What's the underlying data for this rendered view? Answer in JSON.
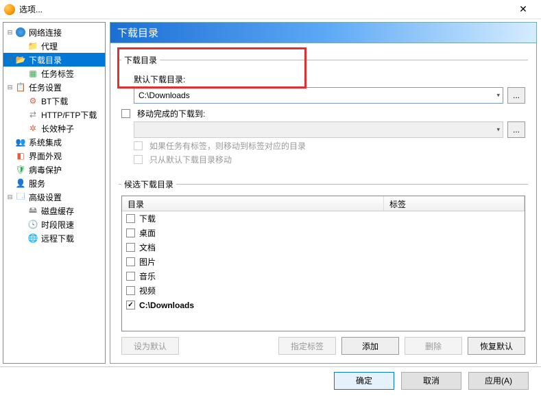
{
  "window": {
    "title": "选项..."
  },
  "sidebar": {
    "items": [
      {
        "label": "网络连接",
        "icon": "globe",
        "level": 0,
        "expanded": true
      },
      {
        "label": "代理",
        "icon": "folder",
        "level": 1
      },
      {
        "label": "下载目录",
        "icon": "folder-open",
        "level": 0,
        "expanded": true,
        "selected": true
      },
      {
        "label": "任务标签",
        "icon": "tag",
        "level": 1
      },
      {
        "label": "任务设置",
        "icon": "clip",
        "level": 0,
        "expanded": true
      },
      {
        "label": "BT下载",
        "icon": "bt",
        "level": 1
      },
      {
        "label": "HTTP/FTP下载",
        "icon": "http",
        "level": 1
      },
      {
        "label": "长效种子",
        "icon": "seed",
        "level": 1
      },
      {
        "label": "系统集成",
        "icon": "users",
        "level": 0
      },
      {
        "label": "界面外观",
        "icon": "ui",
        "level": 0
      },
      {
        "label": "病毒保护",
        "icon": "shield",
        "level": 0
      },
      {
        "label": "服务",
        "icon": "services",
        "level": 0
      },
      {
        "label": "高级设置",
        "icon": "adv",
        "level": 0,
        "expanded": true
      },
      {
        "label": "磁盘缓存",
        "icon": "disk",
        "level": 1
      },
      {
        "label": "时段限速",
        "icon": "time",
        "level": 1
      },
      {
        "label": "远程下载",
        "icon": "remote",
        "level": 1
      }
    ]
  },
  "panel": {
    "header": "下载目录",
    "group1_legend": "下载目录",
    "default_dir_label": "默认下载目录:",
    "default_dir_value": "C:\\Downloads",
    "move_complete_label": "移动完成的下载到:",
    "move_complete_value": "",
    "move_if_tag_label": "如果任务有标签，则移动到标签对应的目录",
    "move_from_default_label": "只从默认下载目录移动",
    "group2_legend": "候选下载目录",
    "table": {
      "col_dir": "目录",
      "col_tag": "标签",
      "rows": [
        {
          "label": "下载",
          "checked": false
        },
        {
          "label": "桌面",
          "checked": false
        },
        {
          "label": "文档",
          "checked": false
        },
        {
          "label": "图片",
          "checked": false
        },
        {
          "label": "音乐",
          "checked": false
        },
        {
          "label": "视频",
          "checked": false
        },
        {
          "label": "C:\\Downloads",
          "checked": true
        }
      ]
    },
    "btn_set_default": "设为默认",
    "btn_assign_tag": "指定标签",
    "btn_add": "添加",
    "btn_delete": "删除",
    "btn_restore": "恢复默认"
  },
  "dialog_buttons": {
    "ok": "确定",
    "cancel": "取消",
    "apply": "应用(A)"
  }
}
